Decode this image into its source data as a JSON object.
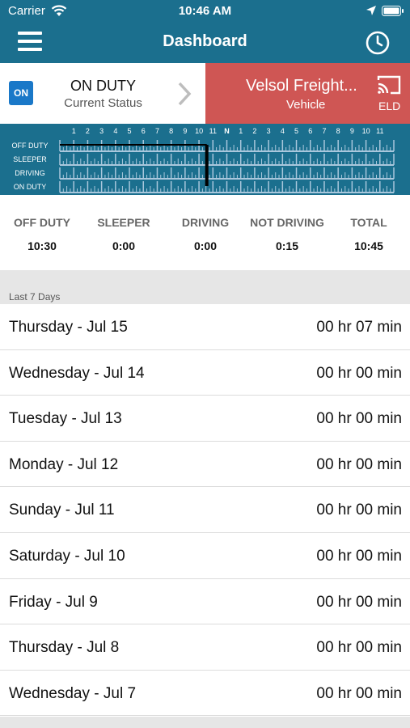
{
  "statusbar": {
    "carrier": "Carrier",
    "time": "10:46 AM"
  },
  "navbar": {
    "title": "Dashboard"
  },
  "status": {
    "badge": "ON",
    "title": "ON DUTY",
    "subtitle": "Current Status"
  },
  "vehicle": {
    "title": "Velsol Freight...",
    "subtitle": "Vehicle",
    "eld": "ELD"
  },
  "graph": {
    "hour_labels": [
      "1",
      "2",
      "3",
      "4",
      "5",
      "6",
      "7",
      "8",
      "9",
      "10",
      "11",
      "N",
      "1",
      "2",
      "3",
      "4",
      "5",
      "6",
      "7",
      "8",
      "9",
      "10",
      "11"
    ],
    "rows": [
      "OFF DUTY",
      "SLEEPER",
      "DRIVING",
      "ON DUTY"
    ]
  },
  "totals": [
    {
      "label": "OFF DUTY",
      "value": "10:30"
    },
    {
      "label": "SLEEPER",
      "value": "0:00"
    },
    {
      "label": "DRIVING",
      "value": "0:00"
    },
    {
      "label": "NOT DRIVING",
      "value": "0:15"
    },
    {
      "label": "TOTAL",
      "value": "10:45"
    }
  ],
  "section_title": "Last 7 Days",
  "days": [
    {
      "date": "Thursday - Jul 15",
      "hours": "00 hr 07 min"
    },
    {
      "date": "Wednesday - Jul 14",
      "hours": "00 hr 00 min"
    },
    {
      "date": "Tuesday - Jul 13",
      "hours": "00 hr 00 min"
    },
    {
      "date": "Monday - Jul 12",
      "hours": "00 hr 00 min"
    },
    {
      "date": "Sunday - Jul 11",
      "hours": "00 hr 00 min"
    },
    {
      "date": "Saturday - Jul 10",
      "hours": "00 hr 00 min"
    },
    {
      "date": "Friday - Jul 9",
      "hours": "00 hr 00 min"
    },
    {
      "date": "Thursday - Jul 8",
      "hours": "00 hr 00 min"
    },
    {
      "date": "Wednesday - Jul 7",
      "hours": "00 hr 00 min"
    }
  ],
  "colors": {
    "header": "#1b6f8e",
    "vehicle": "#cf5654",
    "badge": "#1a78c8",
    "grid": "#a9c7dc"
  }
}
